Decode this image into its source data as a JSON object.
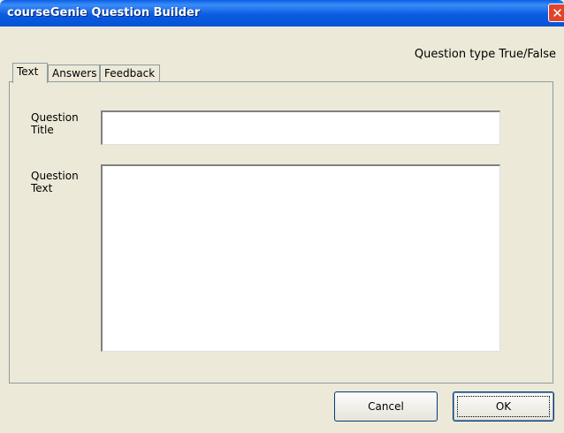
{
  "window": {
    "title": "courseGenie Question Builder",
    "close_glyph": "✕"
  },
  "question_type": "Question type True/False",
  "tabs": [
    {
      "label": "Text",
      "active": true
    },
    {
      "label": "Answers",
      "active": false
    },
    {
      "label": "Feedback",
      "active": false
    }
  ],
  "form": {
    "title_label": "Question\nTitle",
    "title_value": "",
    "text_label": "Question\nText",
    "text_value": ""
  },
  "buttons": {
    "cancel": "Cancel",
    "ok": "OK"
  }
}
